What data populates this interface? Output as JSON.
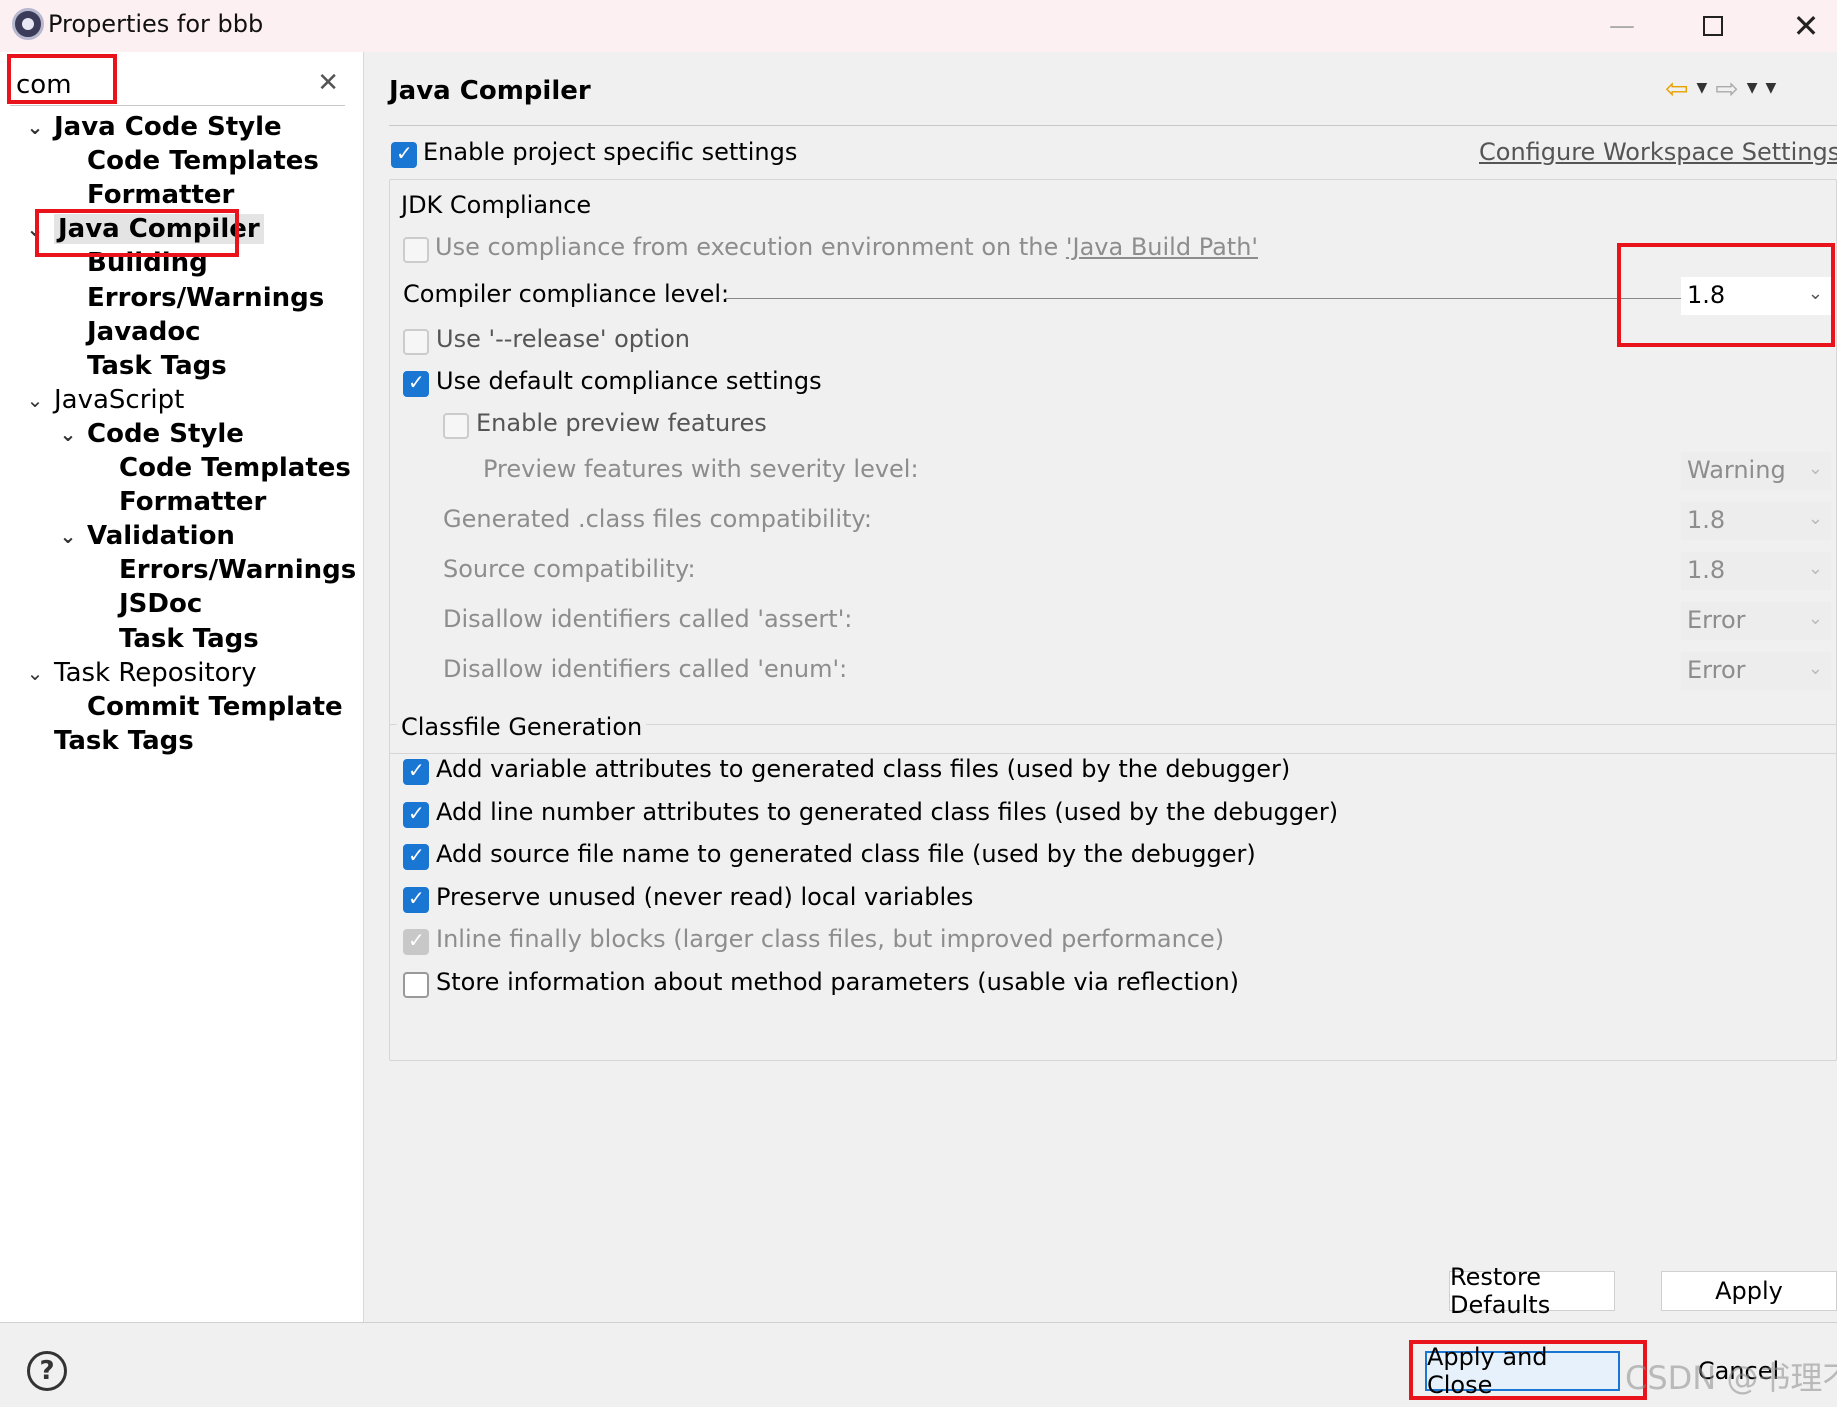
{
  "window": {
    "title": "Properties for bbb",
    "minimize": "—",
    "close": "✕"
  },
  "filter": {
    "value": "com",
    "clear": "✕"
  },
  "tree": [
    {
      "label": "Java Code Style",
      "bold": true,
      "twisty": "⌄"
    },
    {
      "label": "Code Templates",
      "bold": true,
      "twisty": ""
    },
    {
      "label": "Formatter",
      "bold": true,
      "twisty": ""
    },
    {
      "label": "Java Compiler",
      "bold": true,
      "twisty": "⌄",
      "selected": true
    },
    {
      "label": "Building",
      "bold": true,
      "twisty": ""
    },
    {
      "label": "Errors/Warnings",
      "bold": true,
      "twisty": ""
    },
    {
      "label": "Javadoc",
      "bold": true,
      "twisty": ""
    },
    {
      "label": "Task Tags",
      "bold": true,
      "twisty": ""
    },
    {
      "label": "JavaScript",
      "bold": false,
      "twisty": "⌄"
    },
    {
      "label": "Code Style",
      "bold": true,
      "twisty": "⌄"
    },
    {
      "label": "Code Templates",
      "bold": true,
      "twisty": ""
    },
    {
      "label": "Formatter",
      "bold": true,
      "twisty": ""
    },
    {
      "label": "Validation",
      "bold": true,
      "twisty": "⌄"
    },
    {
      "label": "Errors/Warnings",
      "bold": true,
      "twisty": ""
    },
    {
      "label": "JSDoc",
      "bold": true,
      "twisty": ""
    },
    {
      "label": "Task Tags",
      "bold": true,
      "twisty": ""
    },
    {
      "label": "Task Repository",
      "bold": false,
      "twisty": "⌄"
    },
    {
      "label": "Commit Template",
      "bold": true,
      "twisty": ""
    },
    {
      "label": "Task Tags",
      "bold": true,
      "twisty": ""
    }
  ],
  "page": {
    "title": "Java Compiler",
    "enable_specific": {
      "label": "Enable project specific settings",
      "checked": true
    },
    "configure_link": "Configure Workspace Settings..."
  },
  "jdk": {
    "group_title": "JDK Compliance",
    "use_compliance_prefix": "Use compliance from execution environment on the ",
    "use_compliance_link": "'Java Build Path'",
    "compliance_label": "Compiler compliance level:",
    "compliance_value": "1.8",
    "release_label": "Use '--release' option",
    "default_label": "Use default compliance settings",
    "preview_label": "Enable preview features",
    "severity_label": "Preview features with severity level:",
    "severity_value": "Warning",
    "generated_label": "Generated .class files compatibility:",
    "generated_value": "1.8",
    "source_label": "Source compatibility:",
    "source_value": "1.8",
    "assert_label": "Disallow identifiers called 'assert':",
    "assert_value": "Error",
    "enum_label": "Disallow identifiers called 'enum':",
    "enum_value": "Error"
  },
  "classfile": {
    "group_title": "Classfile Generation",
    "options": [
      {
        "label": "Add variable attributes to generated class files (used by the debugger)",
        "state": "on"
      },
      {
        "label": "Add line number attributes to generated class files (used by the debugger)",
        "state": "on"
      },
      {
        "label": "Add source file name to generated class file (used by the debugger)",
        "state": "on"
      },
      {
        "label": "Preserve unused (never read) local variables",
        "state": "on"
      },
      {
        "label": "Inline finally blocks (larger class files, but improved performance)",
        "state": "disabled-on"
      },
      {
        "label": "Store information about method parameters (usable via reflection)",
        "state": "off"
      }
    ]
  },
  "buttons": {
    "restore_defaults": "Restore Defaults",
    "apply": "Apply",
    "apply_and_close": "Apply and Close",
    "cancel": "Cancel",
    "help": "?"
  },
  "watermark": "CSDN @书理不住我",
  "colors": {
    "accent": "#1976d2",
    "highlight_box": "#e8131b",
    "back_arrow": "#e8a000"
  }
}
